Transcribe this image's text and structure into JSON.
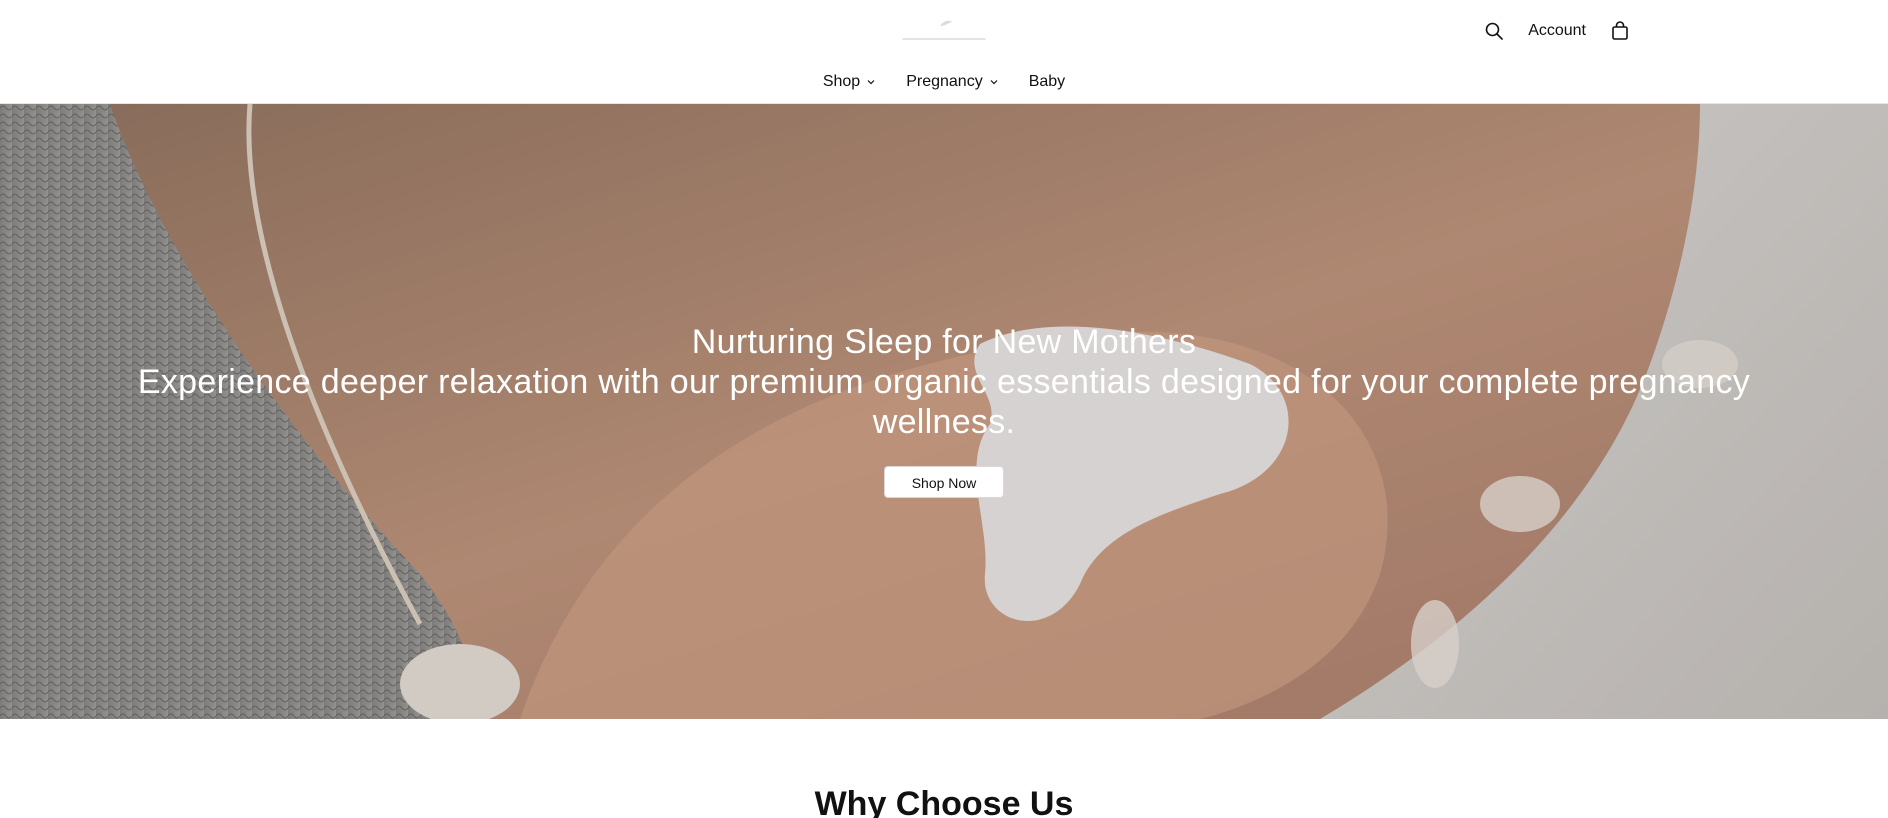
{
  "header": {
    "logo": "logo-mark",
    "search_icon": "search-icon",
    "account_label": "Account",
    "cart_icon": "shopping-bag-icon"
  },
  "nav": {
    "items": [
      {
        "label": "Shop",
        "has_dropdown": true
      },
      {
        "label": "Pregnancy",
        "has_dropdown": true
      },
      {
        "label": "Baby",
        "has_dropdown": false
      }
    ]
  },
  "hero": {
    "title": "Nurturing Sleep for New Mothers",
    "subtitle": "Experience deeper relaxation with our premium organic essentials designed for your complete pregnancy wellness.",
    "button_label": "Shop Now"
  },
  "section": {
    "title": "Why Choose Us"
  },
  "colors": {
    "text": "#111111",
    "hero_text": "#ffffff",
    "button_bg": "#ffffff"
  }
}
